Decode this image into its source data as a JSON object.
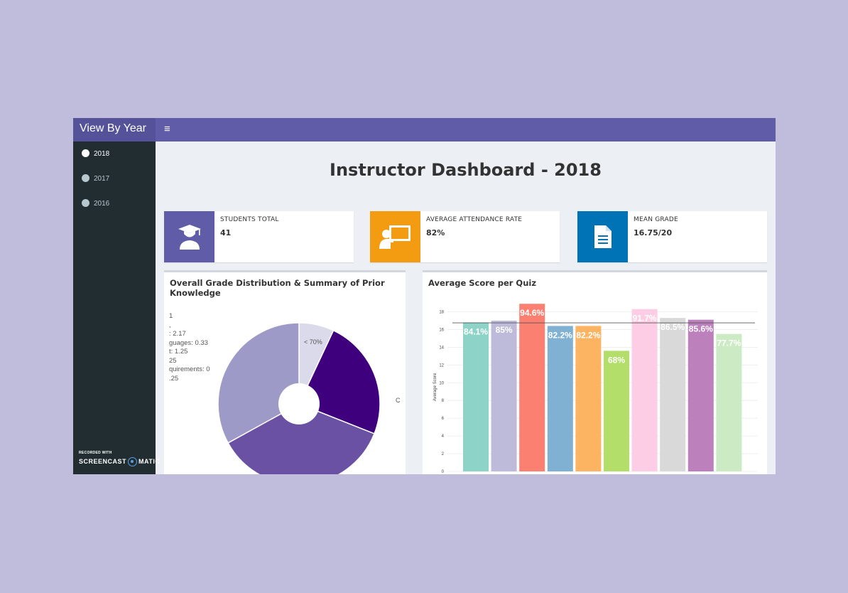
{
  "brand": "View By Year",
  "menu_icon": "hamburger-icon",
  "sidebar": {
    "items": [
      {
        "label": "2018",
        "icon": "dashboard-icon",
        "active": true
      },
      {
        "label": "2017",
        "icon": "dashboard-icon",
        "active": false
      },
      {
        "label": "2016",
        "icon": "dashboard-icon",
        "active": false
      }
    ],
    "watermark": {
      "small": "RECORDED WITH",
      "big_left": "SCREENCAST",
      "big_right": "MATIC"
    }
  },
  "page_title": "Instructor Dashboard - 2018",
  "infoboxes": [
    {
      "label": "STUDENTS TOTAL",
      "value": "41",
      "color": "#605ca8",
      "icon": "graduate-icon"
    },
    {
      "label": "AVERAGE ATTENDANCE RATE",
      "value": "82%",
      "color": "#f39c12",
      "icon": "presentation-icon"
    },
    {
      "label": "MEAN GRADE",
      "value": "16.75/20",
      "color": "#0073b7",
      "icon": "document-icon"
    }
  ],
  "pie_box": {
    "title_line1": "Overall Grade Distribution & Summary of Prior",
    "title_line2": "Knowledge",
    "legend_fragments": [
      "1",
      ",",
      ": 2.17",
      "guages: 0.33",
      "t: 1.25",
      "25",
      "quirements: 0",
      ".25"
    ],
    "slice_label": "< 70%",
    "edge_label": "C"
  },
  "bar_box": {
    "title": "Average Score per Quiz"
  },
  "chart_data": [
    {
      "type": "pie",
      "title": "Overall Grade Distribution & Summary of Prior Knowledge",
      "slices": [
        {
          "label": "< 70%",
          "value": 7,
          "color": "#dadaeb"
        },
        {
          "label": "",
          "value": 24,
          "color": "#3f007d"
        },
        {
          "label": "",
          "value": 36,
          "color": "#6a51a3"
        },
        {
          "label": "",
          "value": 33,
          "color": "#9e9ac8"
        }
      ]
    },
    {
      "type": "bar",
      "title": "Average Score per Quiz",
      "xlabel": "",
      "ylabel": "Average Score",
      "ylim": [
        0,
        19
      ],
      "yticks": [
        0,
        2,
        4,
        6,
        8,
        10,
        12,
        14,
        16,
        18
      ],
      "reference_line": 16.75,
      "values": [
        16.8,
        17.0,
        18.9,
        16.4,
        16.4,
        13.6,
        18.3,
        17.3,
        17.1,
        15.5
      ],
      "data_labels": [
        "84.1%",
        "85%",
        "94.6%",
        "82.2%",
        "82.2%",
        "68%",
        "91.7%",
        "86.5%",
        "85.6%",
        "77.7%"
      ],
      "colors": [
        "#8dd3c7",
        "#bebada",
        "#fb8072",
        "#80b1d3",
        "#fdb462",
        "#b3de69",
        "#fccde5",
        "#d9d9d9",
        "#bc80bd",
        "#ccebc5"
      ]
    }
  ]
}
